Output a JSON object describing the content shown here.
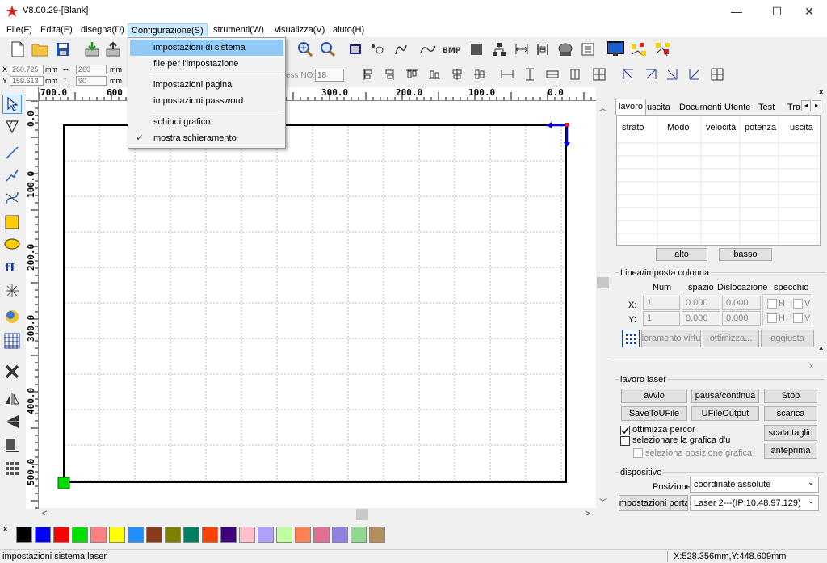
{
  "window": {
    "title": "V8.00.29-[Blank]",
    "minimize": "—",
    "maximize": "☐",
    "close": "✕"
  },
  "menu": {
    "items": [
      "File(F)",
      "Edita(E)",
      "disegna(D)",
      "Configurazione(S)",
      "strumenti(W)",
      "visualizza(V)",
      "aiuto(H)"
    ],
    "open_menu": "Configurazione(S)",
    "dropdown": {
      "items": [
        "impostazioni di sistema",
        "file per l'impostazione",
        "impostazioni pagina",
        "impostazioni password",
        "schiudi grafico",
        "mostra schieramento"
      ],
      "highlighted": "impostazioni di sistema",
      "checked": "mostra schieramento"
    }
  },
  "toolbar2": {
    "x_label": "X",
    "y_label": "Y",
    "x_value": "260.725",
    "y_value": "159.613",
    "unit": "mm",
    "w_value": "260",
    "h_value": "90",
    "w_unit": "mm",
    "h_unit": "mm",
    "process_label": "ess NO:",
    "process_no": "18"
  },
  "rulers": {
    "h": [
      "700.0",
      "600",
      "300.0",
      "200.0",
      "100.0",
      "0.0"
    ],
    "v": [
      "0.0",
      "100.0",
      "200.0",
      "300.0",
      "400.0",
      "500.0"
    ]
  },
  "panel": {
    "tabs": [
      "lavoro",
      "uscita",
      "Documenti",
      "Utente",
      "Test",
      "Tra"
    ],
    "active_tab": "lavoro",
    "table_headers": [
      "strato",
      "Modo",
      "velocità",
      "potenza",
      "uscita"
    ],
    "up_button": "alto",
    "down_button": "basso",
    "array": {
      "group_label": "Linea/imposta colonna",
      "col_num": "Num",
      "col_space": "spazio",
      "col_disloc": "Dislocazione",
      "col_mirror": "specchio",
      "x_label": "X:",
      "y_label": "Y:",
      "x_num": "1",
      "x_space": "0.000",
      "x_disloc": "0.000",
      "y_num": "1",
      "y_space": "0.000",
      "y_disloc": "0.000",
      "mirror_h": "H",
      "mirror_v": "V",
      "virtual_button": "ieramento virtu",
      "optimize_button": "ottimizza...",
      "adjust_button": "aggiusta"
    },
    "laser_work": {
      "group_label": "lavoro laser",
      "start": "avvio",
      "pause": "pausa/continua",
      "stop": "Stop",
      "save_ufile": "SaveToUFile",
      "ufile_output": "UFileOutput",
      "download": "scarica",
      "optimize_path": "ottimizza percor",
      "select_graphic": "selezionare la grafica d'u",
      "select_position": "seleziona posizione grafica",
      "scale_cut": "scala taglio",
      "preview": "anteprima"
    },
    "device": {
      "group_label": "dispositivo",
      "position_label": "Posizione:",
      "position_value": "coordinate assolute",
      "port_button": "impostazioni porta",
      "laser_value": "Laser 2---(IP:10.48.97.129)"
    }
  },
  "palette": [
    "#000000",
    "#0000ff",
    "#ff0000",
    "#00e000",
    "#ff8080",
    "#ffff00",
    "#1e90ff",
    "#8b3a1a",
    "#808000",
    "#008060",
    "#ff4000",
    "#400080",
    "#ffc0cb",
    "#b0a0ff",
    "#c0ffa0",
    "#ff8050",
    "#e07090",
    "#9080e0",
    "#90d890",
    "#b09060"
  ],
  "status": {
    "left": "impostazioni sistema laser",
    "coords": "X:528.356mm,Y:448.609mm"
  }
}
